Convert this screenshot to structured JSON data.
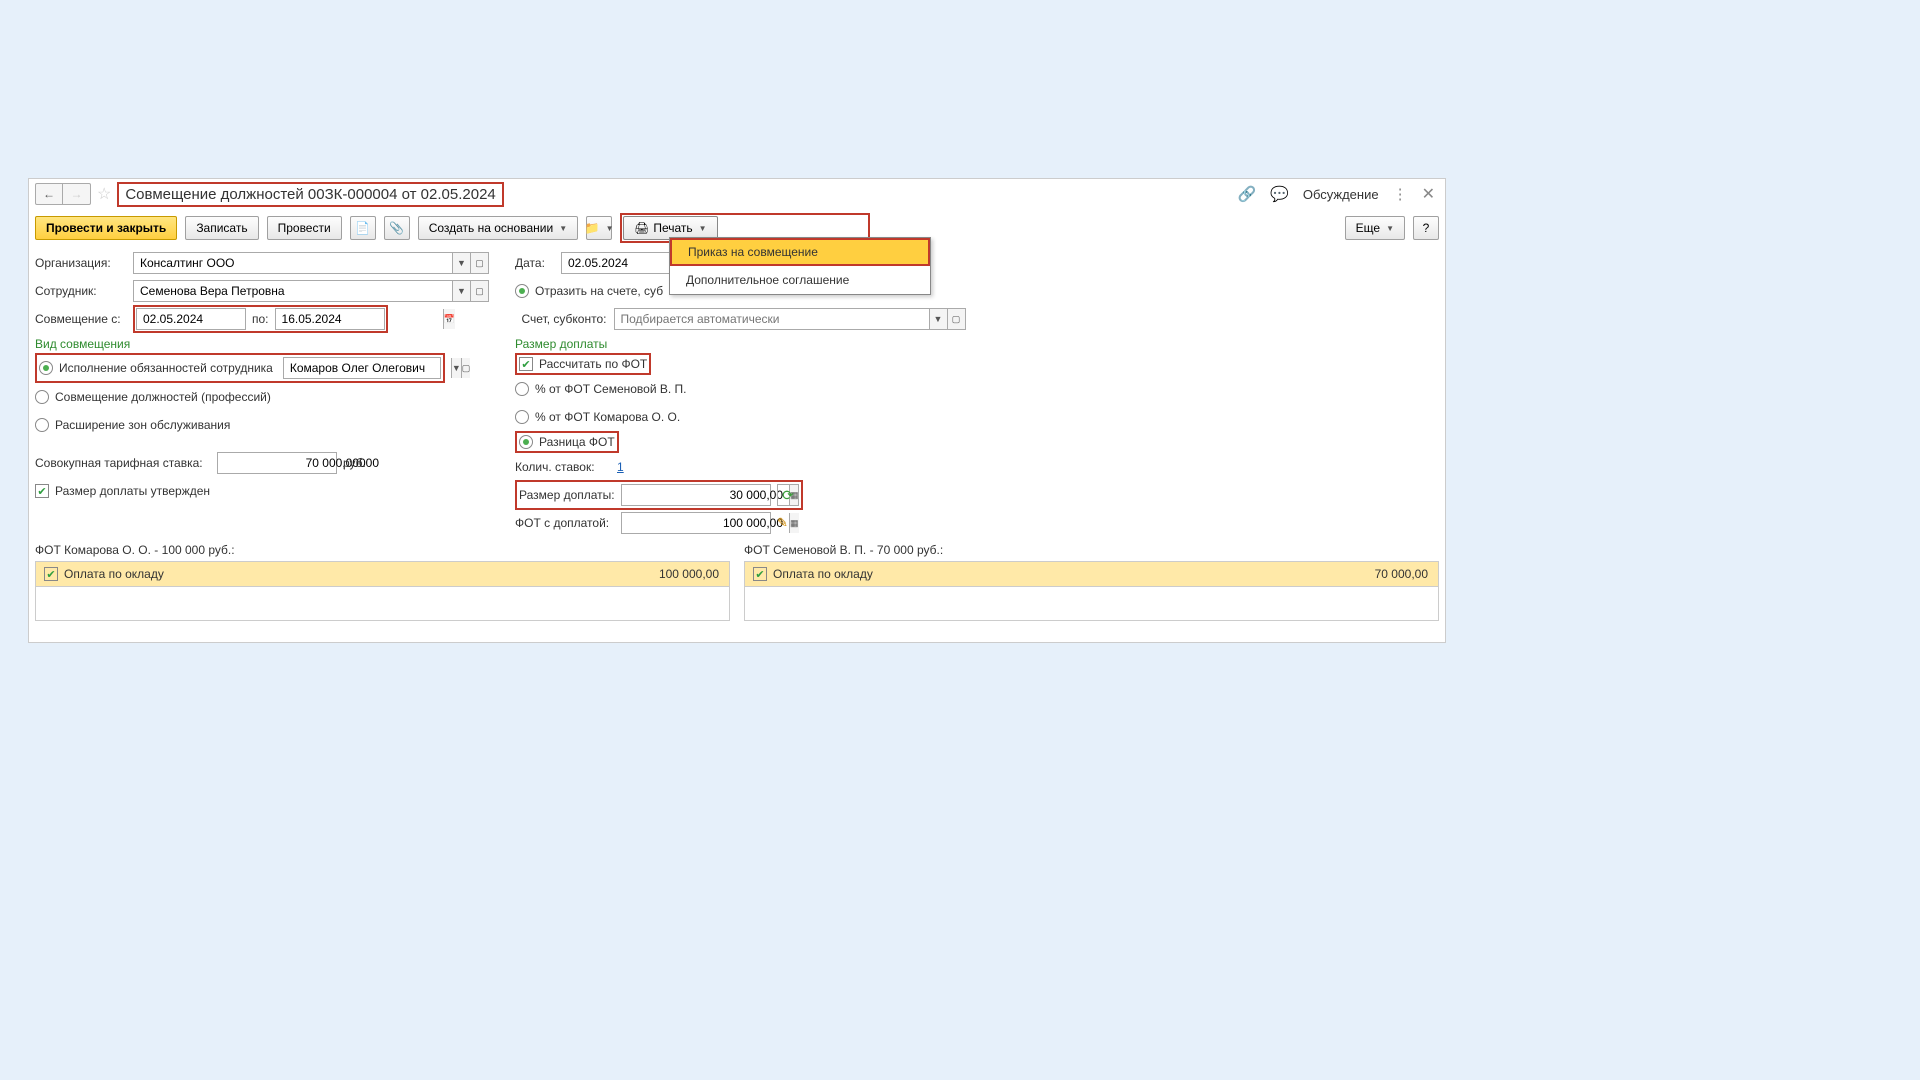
{
  "title": "Совмещение должностей 00ЗК-000004 от 02.05.2024",
  "titlebar": {
    "discuss": "Обсуждение"
  },
  "toolbar": {
    "post_close": "Провести и закрыть",
    "write": "Записать",
    "post": "Провести",
    "create_based": "Создать на основании",
    "print": "Печать",
    "more": "Еще",
    "help": "?"
  },
  "print_menu": {
    "item1": "Приказ на совмещение",
    "item2": "Дополнительное соглашение"
  },
  "form": {
    "org_label": "Организация:",
    "org_value": "Консалтинг ООО",
    "date_label": "Дата:",
    "date_value": "02.05.2024",
    "emp_label": "Сотрудник:",
    "emp_value": "Семенова Вера Петровна",
    "reflect_label": "Отразить на счете, суб",
    "combine_label": "Совмещение с:",
    "from_value": "02.05.2024",
    "to_label": "по:",
    "to_value": "16.05.2024",
    "account_label": "Счет, субконто:",
    "account_placeholder": "Подбирается автоматически"
  },
  "type_section": {
    "title": "Вид совмещения",
    "r1": "Исполнение обязанностей сотрудника",
    "r1_person": "Комаров Олег Олегович",
    "r2": "Совмещение должностей (профессий)",
    "r3": "Расширение зон обслуживания"
  },
  "rate": {
    "label": "Совокупная тарифная ставка:",
    "value": "70 000,00000",
    "unit": "руб.",
    "approved_label": "Размер доплаты утвержден"
  },
  "pay_section": {
    "title": "Размер доплаты",
    "calc_fot": "Рассчитать по ФОТ",
    "r1": "% от ФОТ Семеновой В. П.",
    "r2": "% от ФОТ Комарова О. О.",
    "r3": "Разница ФОТ",
    "count_label": "Колич. ставок:",
    "count_value": "1",
    "amount_label": "Размер доплаты:",
    "amount_value": "30 000,00",
    "total_label": "ФОТ с доплатой:",
    "total_value": "100 000,00"
  },
  "tables": {
    "left_title": "ФОТ Комарова О. О. - 100 000 руб.:",
    "left_item": "Оплата по окладу",
    "left_amount": "100 000,00",
    "right_title": "ФОТ Семеновой В. П. - 70 000 руб.:",
    "right_item": "Оплата по окладу",
    "right_amount": "70 000,00"
  }
}
